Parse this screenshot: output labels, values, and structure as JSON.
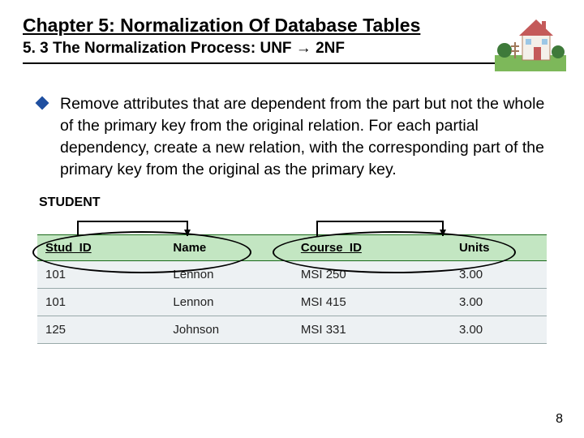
{
  "header": {
    "chapter_title": "Chapter 5: Normalization Of Database Tables",
    "section_title": "5. 3 The Normalization Process: UNF → 2NF"
  },
  "body": {
    "bullet_text": "Remove attributes that are dependent from the part but not the whole of the primary key from the original relation. For each partial dependency, create a new relation, with the corresponding part of the primary key from the original as the primary key."
  },
  "table": {
    "caption": "STUDENT",
    "headers": [
      "Stud_ID",
      "Name",
      "Course_ID",
      "Units"
    ],
    "key_cols": [
      0,
      2
    ],
    "rows": [
      [
        "101",
        "Lennon",
        "MSI 250",
        "3.00"
      ],
      [
        "101",
        "Lennon",
        "MSI 415",
        "3.00"
      ],
      [
        "125",
        "Johnson",
        "MSI 331",
        "3.00"
      ]
    ]
  },
  "page_number": "8"
}
